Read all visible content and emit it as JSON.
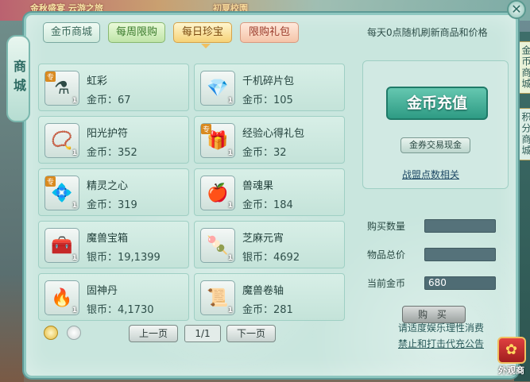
{
  "background": {
    "top_texts": [
      "金秋盛宴 云游之旅",
      "初夏校園"
    ],
    "side_tags": [
      "金币商城",
      "积分商城"
    ]
  },
  "window": {
    "side_title": "商城",
    "close_label": "✕"
  },
  "tabs": [
    {
      "label": "金币商城",
      "style": "green"
    },
    {
      "label": "每周限购",
      "style": "weekly"
    },
    {
      "label": "每日珍宝",
      "style": "active"
    },
    {
      "label": "限购礼包",
      "style": "limited"
    }
  ],
  "refresh_note": "每天0点随机刷新商品和价格",
  "items": [
    {
      "name": "虹彩",
      "currency": "金币",
      "price": "67",
      "qty": "1",
      "badge": "专",
      "icon": "potion-icon",
      "glyph": "⚗"
    },
    {
      "name": "千机碎片包",
      "currency": "金币",
      "price": "105",
      "qty": "1",
      "badge": "",
      "icon": "shard-bag-icon",
      "glyph": "💎"
    },
    {
      "name": "阳光护符",
      "currency": "金币",
      "price": "352",
      "qty": "1",
      "badge": "",
      "icon": "amulet-icon",
      "glyph": "📿"
    },
    {
      "name": "经验心得礼包",
      "currency": "金币",
      "price": "32",
      "qty": "1",
      "badge": "专",
      "icon": "gift-bag-icon",
      "glyph": "🎁"
    },
    {
      "name": "精灵之心",
      "currency": "金币",
      "price": "319",
      "qty": "1",
      "badge": "专",
      "icon": "spirit-heart-icon",
      "glyph": "💠"
    },
    {
      "name": "兽魂果",
      "currency": "金币",
      "price": "184",
      "qty": "1",
      "badge": "",
      "icon": "fruit-icon",
      "glyph": "🍎"
    },
    {
      "name": "魔兽宝箱",
      "currency": "银币",
      "price": "19,1399",
      "qty": "1",
      "badge": "",
      "icon": "treasure-chest-icon",
      "glyph": "🧰"
    },
    {
      "name": "芝麻元宵",
      "currency": "银币",
      "price": "4692",
      "qty": "1",
      "badge": "",
      "icon": "rice-ball-icon",
      "glyph": "🍡"
    },
    {
      "name": "固神丹",
      "currency": "银币",
      "price": "4,1730",
      "qty": "1",
      "badge": "",
      "icon": "pill-icon",
      "glyph": "🔥"
    },
    {
      "name": "魔兽卷轴",
      "currency": "金币",
      "price": "281",
      "qty": "1",
      "badge": "",
      "icon": "scroll-icon",
      "glyph": "📜"
    }
  ],
  "right_panel": {
    "recharge_label": "金币充值",
    "exchange_label": "金券交易现金",
    "guild_link": "战盟点数相关"
  },
  "purchase": {
    "quantity_label": "购买数量",
    "quantity_value": "",
    "total_label": "物品总价",
    "total_value": "",
    "current_gold_label": "当前金币",
    "current_gold_value": "680",
    "buy_label": "购 买"
  },
  "pagination": {
    "prev_label": "上一页",
    "page": "1/1",
    "next_label": "下一页"
  },
  "footer": {
    "note1": "请适度娱乐理性消费",
    "note2": "禁止和打击代充公告"
  },
  "outfit_shop": {
    "label": "外观商"
  },
  "colors": {
    "window_bg": "#c9e6de",
    "active_tab": "#f6d277",
    "recharge": "#2e9b84"
  }
}
